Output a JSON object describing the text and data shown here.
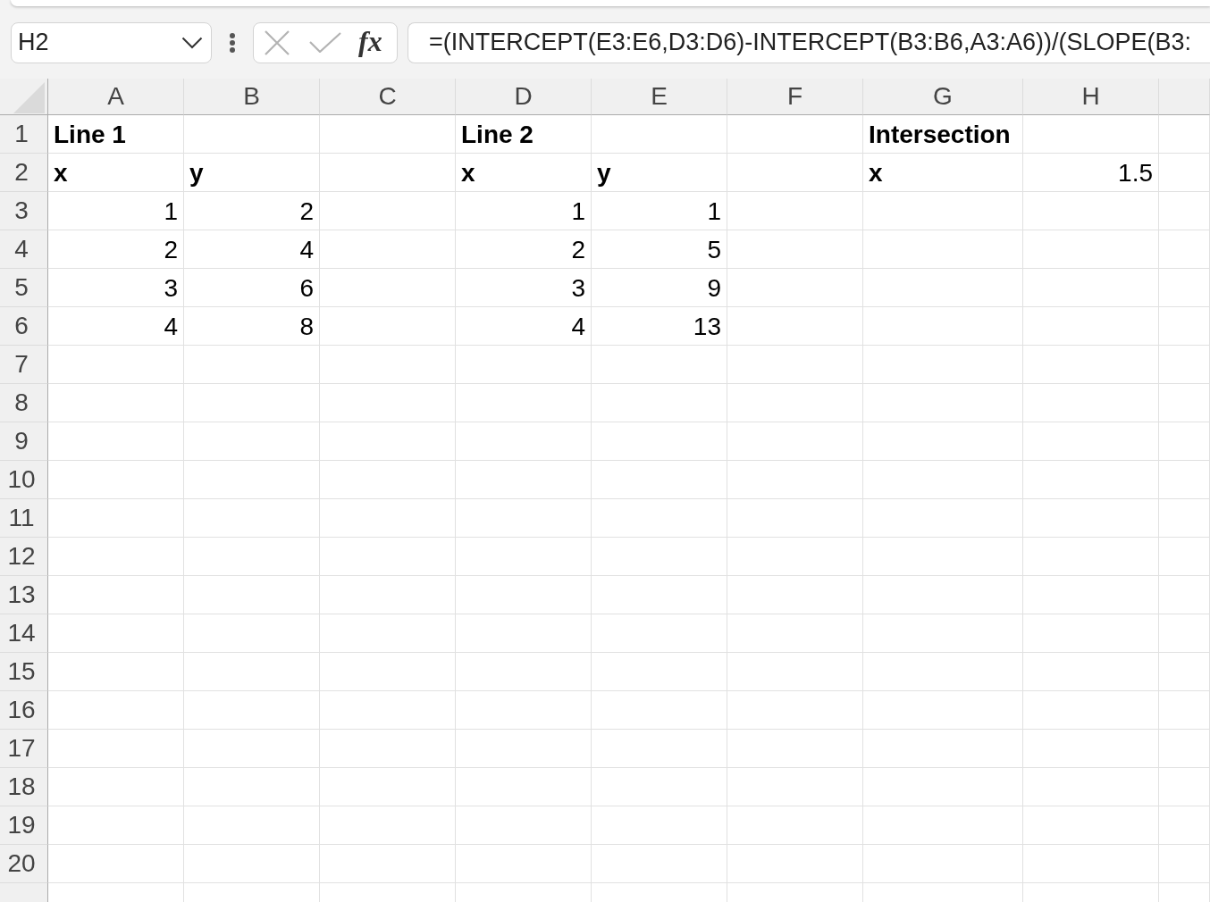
{
  "name_box": {
    "value": "H2"
  },
  "formula_bar": {
    "function_button": "fx",
    "value": "=(INTERCEPT(E3:E6,D3:D6)-INTERCEPT(B3:B6,A3:A6))/(SLOPE(B3:"
  },
  "columns": [
    "A",
    "B",
    "C",
    "D",
    "E",
    "F",
    "G",
    "H"
  ],
  "rows": [
    {
      "number": "1",
      "cells": [
        {
          "kind": "label",
          "text": "Line 1"
        },
        {
          "kind": "blank"
        },
        {
          "kind": "blank"
        },
        {
          "kind": "label",
          "text": "Line 2"
        },
        {
          "kind": "blank"
        },
        {
          "kind": "blank"
        },
        {
          "kind": "label",
          "text": "Intersection"
        },
        {
          "kind": "blank"
        }
      ]
    },
    {
      "number": "2",
      "cells": [
        {
          "kind": "label",
          "text": "x"
        },
        {
          "kind": "label",
          "text": "y"
        },
        {
          "kind": "blank"
        },
        {
          "kind": "label",
          "text": "x"
        },
        {
          "kind": "label",
          "text": "y"
        },
        {
          "kind": "blank"
        },
        {
          "kind": "label",
          "text": "x"
        },
        {
          "kind": "number",
          "text": "1.5"
        }
      ]
    },
    {
      "number": "3",
      "cells": [
        {
          "kind": "number",
          "text": "1"
        },
        {
          "kind": "number",
          "text": "2"
        },
        {
          "kind": "blank"
        },
        {
          "kind": "number",
          "text": "1"
        },
        {
          "kind": "number",
          "text": "1"
        },
        {
          "kind": "blank"
        },
        {
          "kind": "blank"
        },
        {
          "kind": "blank"
        }
      ]
    },
    {
      "number": "4",
      "cells": [
        {
          "kind": "number",
          "text": "2"
        },
        {
          "kind": "number",
          "text": "4"
        },
        {
          "kind": "blank"
        },
        {
          "kind": "number",
          "text": "2"
        },
        {
          "kind": "number",
          "text": "5"
        },
        {
          "kind": "blank"
        },
        {
          "kind": "blank"
        },
        {
          "kind": "blank"
        }
      ]
    },
    {
      "number": "5",
      "cells": [
        {
          "kind": "number",
          "text": "3"
        },
        {
          "kind": "number",
          "text": "6"
        },
        {
          "kind": "blank"
        },
        {
          "kind": "number",
          "text": "3"
        },
        {
          "kind": "number",
          "text": "9"
        },
        {
          "kind": "blank"
        },
        {
          "kind": "blank"
        },
        {
          "kind": "blank"
        }
      ]
    },
    {
      "number": "6",
      "cells": [
        {
          "kind": "number",
          "text": "4"
        },
        {
          "kind": "number",
          "text": "8"
        },
        {
          "kind": "blank"
        },
        {
          "kind": "number",
          "text": "4"
        },
        {
          "kind": "number",
          "text": "13"
        },
        {
          "kind": "blank"
        },
        {
          "kind": "blank"
        },
        {
          "kind": "blank"
        }
      ]
    },
    {
      "number": "7"
    },
    {
      "number": "8"
    },
    {
      "number": "9"
    },
    {
      "number": "10"
    },
    {
      "number": "11"
    },
    {
      "number": "12"
    },
    {
      "number": "13"
    },
    {
      "number": "14"
    },
    {
      "number": "15"
    },
    {
      "number": "16"
    },
    {
      "number": "17"
    },
    {
      "number": "18"
    },
    {
      "number": "19"
    },
    {
      "number": "20"
    }
  ]
}
